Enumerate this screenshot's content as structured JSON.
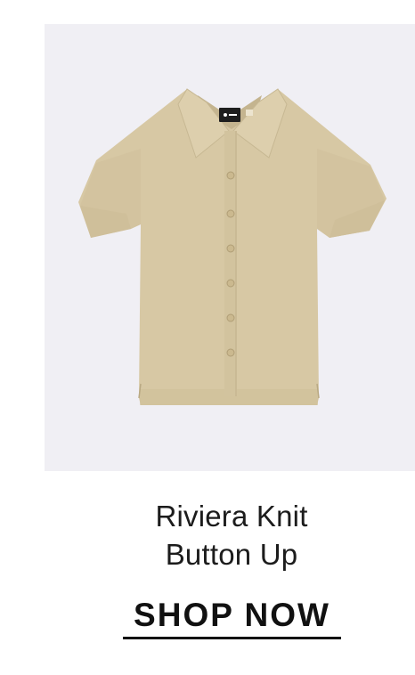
{
  "product": {
    "name_line1": "Riviera Knit",
    "name_line2": "Button Up",
    "image_icon": "tan-short-sleeve-knit-shirt-image",
    "label_icon": "shirt-brand-label-icon",
    "colors": {
      "background": "#f0eff4",
      "shirt": "#d7c8a4",
      "text": "#1c1c1c"
    }
  },
  "cta": {
    "label": "SHOP NOW"
  }
}
